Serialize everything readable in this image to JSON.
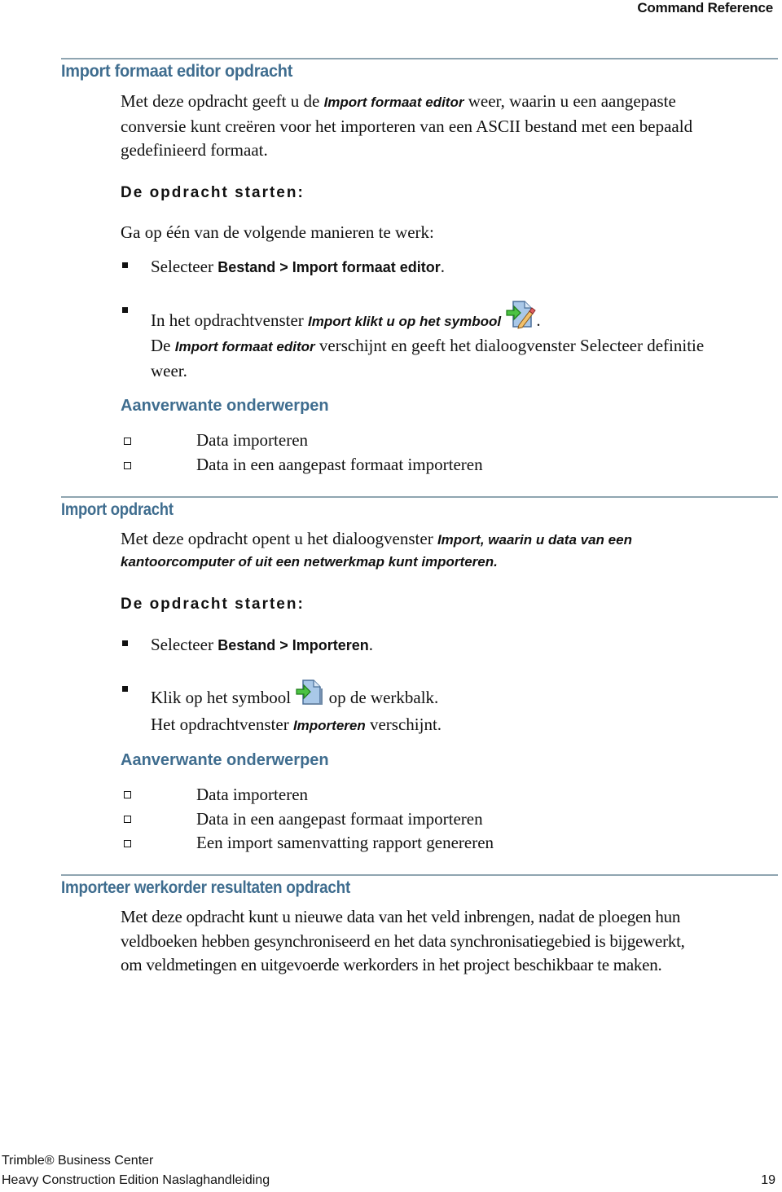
{
  "header": {
    "running_title": "Command Reference"
  },
  "section1": {
    "title": "Import formaat editor opdracht",
    "intro_a": "Met deze opdracht geeft u de ",
    "intro_em": "Import formaat editor",
    "intro_b": " weer, waarin u een aangepaste",
    "intro_line2": "conversie kunt creëren voor het importeren van een ASCII bestand met een bepaald",
    "intro_line3": "gedefinieerd formaat.",
    "start_heading": "De opdracht starten:",
    "instruction": "Ga op één van de volgende manieren te werk:",
    "step1_a": "Selecteer ",
    "step1_b": "Bestand > Import formaat editor",
    "step1_c": ".",
    "step2_a": "In het opdrachtvenster ",
    "step2_em": "Import klikt u op het symbool",
    "step2_c": ".",
    "result_a": "De ",
    "result_em": "Import formaat editor",
    "result_b": " verschijnt en geeft het dialoogvenster Selecteer definitie",
    "result_line2": "weer.",
    "related_heading": "Aanverwante onderwerpen",
    "related": [
      "Data importeren",
      "Data in een aangepast formaat importeren"
    ]
  },
  "section2": {
    "title": "Import opdracht",
    "intro_a": "Met deze opdracht opent u het dialoogvenster ",
    "intro_em": "Import, waarin u data van een",
    "intro_line2_em": "kantoorcomputer of uit een netwerkmap kunt importeren.",
    "start_heading": "De opdracht starten:",
    "step1_a": "Selecteer ",
    "step1_b": "Bestand > Importeren",
    "step1_c": ".",
    "step2_a": "Klik op het symbool ",
    "step2_b": " op de werkbalk.",
    "result_a": "Het opdrachtvenster ",
    "result_em": "Importeren",
    "result_b": " verschijnt.",
    "related_heading": "Aanverwante onderwerpen",
    "related": [
      "Data importeren",
      "Data in een aangepast formaat importeren",
      "Een import samenvatting rapport genereren"
    ]
  },
  "section3": {
    "title": "Importeer werkorder resultaten opdracht",
    "line1": "Met deze opdracht kunt u nieuwe data van het veld inbrengen, nadat de ploegen hun",
    "line2": "veldboeken hebben gesynchroniseerd en het data synchronisatiegebied is bijgewerkt,",
    "line3": "om veldmetingen en uitgevoerde werkorders in het project beschikbaar te maken."
  },
  "footer": {
    "product": "Trimble® Business Center",
    "edition": "Heavy Construction Edition Naslaghandleiding",
    "page_number": "19"
  },
  "icons": {
    "import_format_editor": "import-format-editor-icon",
    "import": "import-icon"
  },
  "colors": {
    "heading": "#3f6d8f",
    "rule": "#8fa5b1",
    "text": "#111111"
  }
}
